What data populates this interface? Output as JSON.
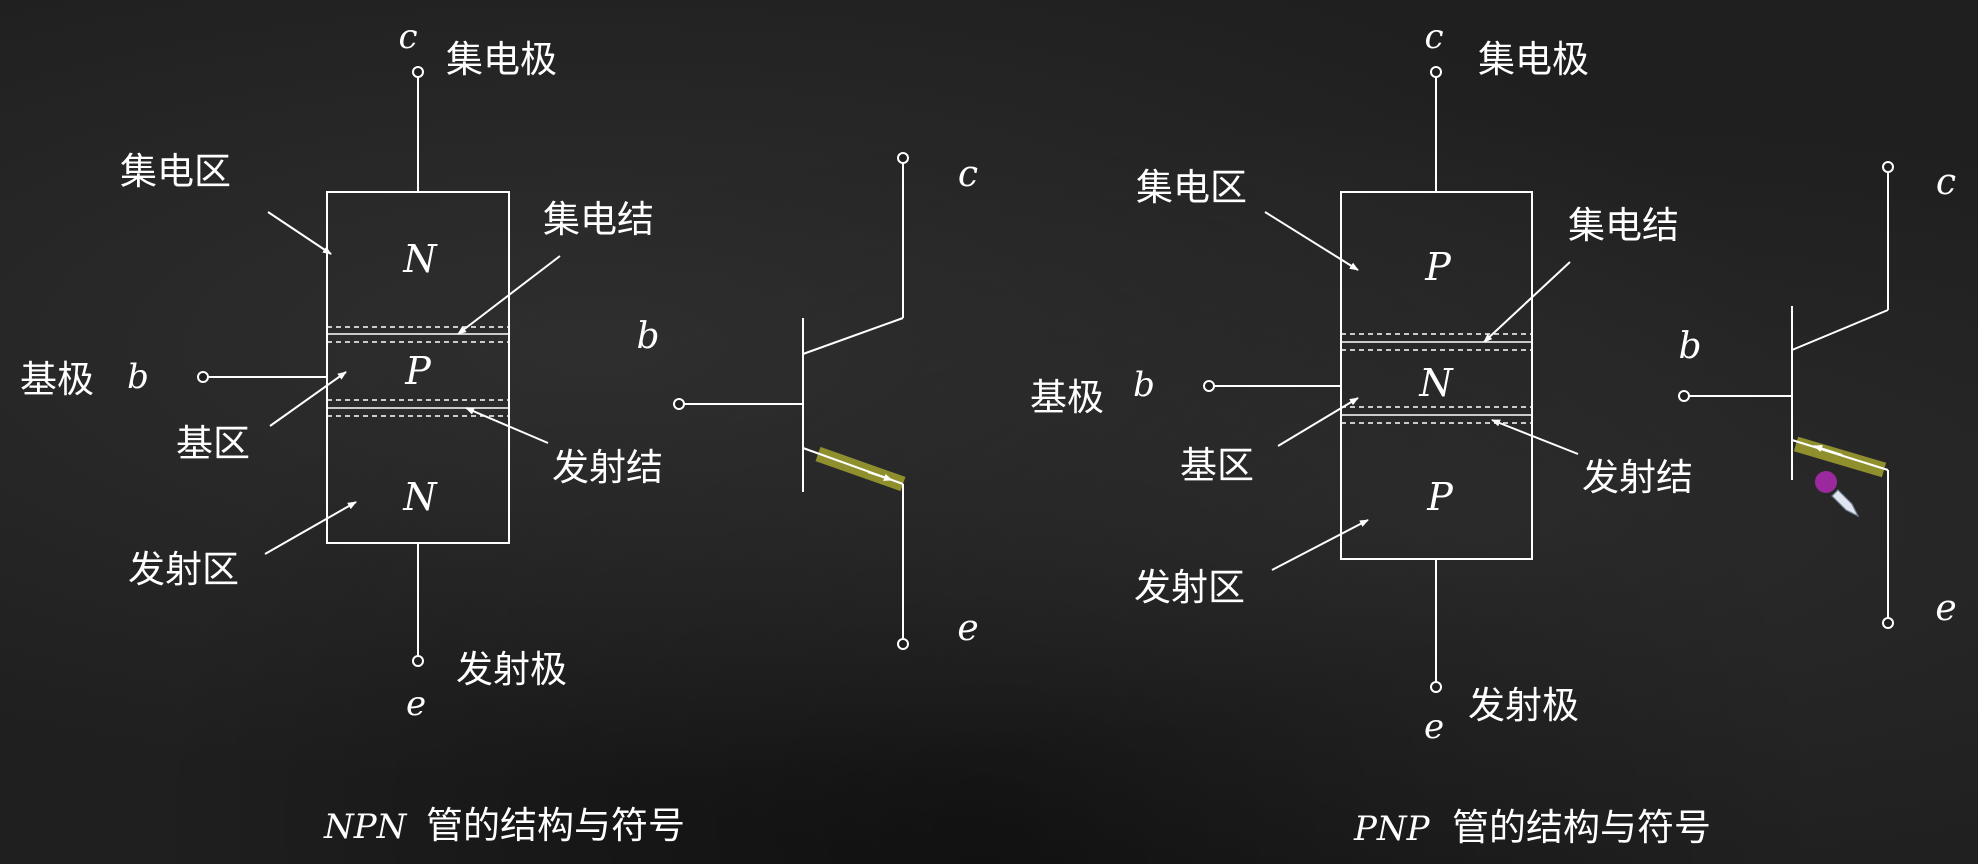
{
  "npn": {
    "collector_letter": "c",
    "collector_label": "集电极",
    "collector_region_label": "集电区",
    "collector_junction_label": "集电结",
    "base_label": "基极",
    "base_letter": "b",
    "base_region_label": "基区",
    "emitter_junction_label": "发射结",
    "emitter_region_label": "发射区",
    "emitter_label": "发射极",
    "emitter_letter": "e",
    "layers": [
      "N",
      "P",
      "N"
    ],
    "symbol": {
      "b": "b",
      "c": "c",
      "e": "e"
    },
    "caption_prefix": "NPN",
    "caption_text": "管的结构与符号"
  },
  "pnp": {
    "collector_letter": "c",
    "collector_label": "集电极",
    "collector_region_label": "集电区",
    "collector_junction_label": "集电结",
    "base_label": "基极",
    "base_letter": "b",
    "base_region_label": "基区",
    "emitter_junction_label": "发射结",
    "emitter_region_label": "发射区",
    "emitter_label": "发射极",
    "emitter_letter": "e",
    "layers": [
      "P",
      "N",
      "P"
    ],
    "symbol": {
      "b": "b",
      "c": "c",
      "e": "e"
    },
    "caption_prefix": "PNP",
    "caption_text": "管的结构与符号"
  },
  "colors": {
    "background": "#1f1f1f",
    "chalk": "#ffffff",
    "highlight": "#8f8f2e",
    "pointer": "#b02ab4"
  }
}
